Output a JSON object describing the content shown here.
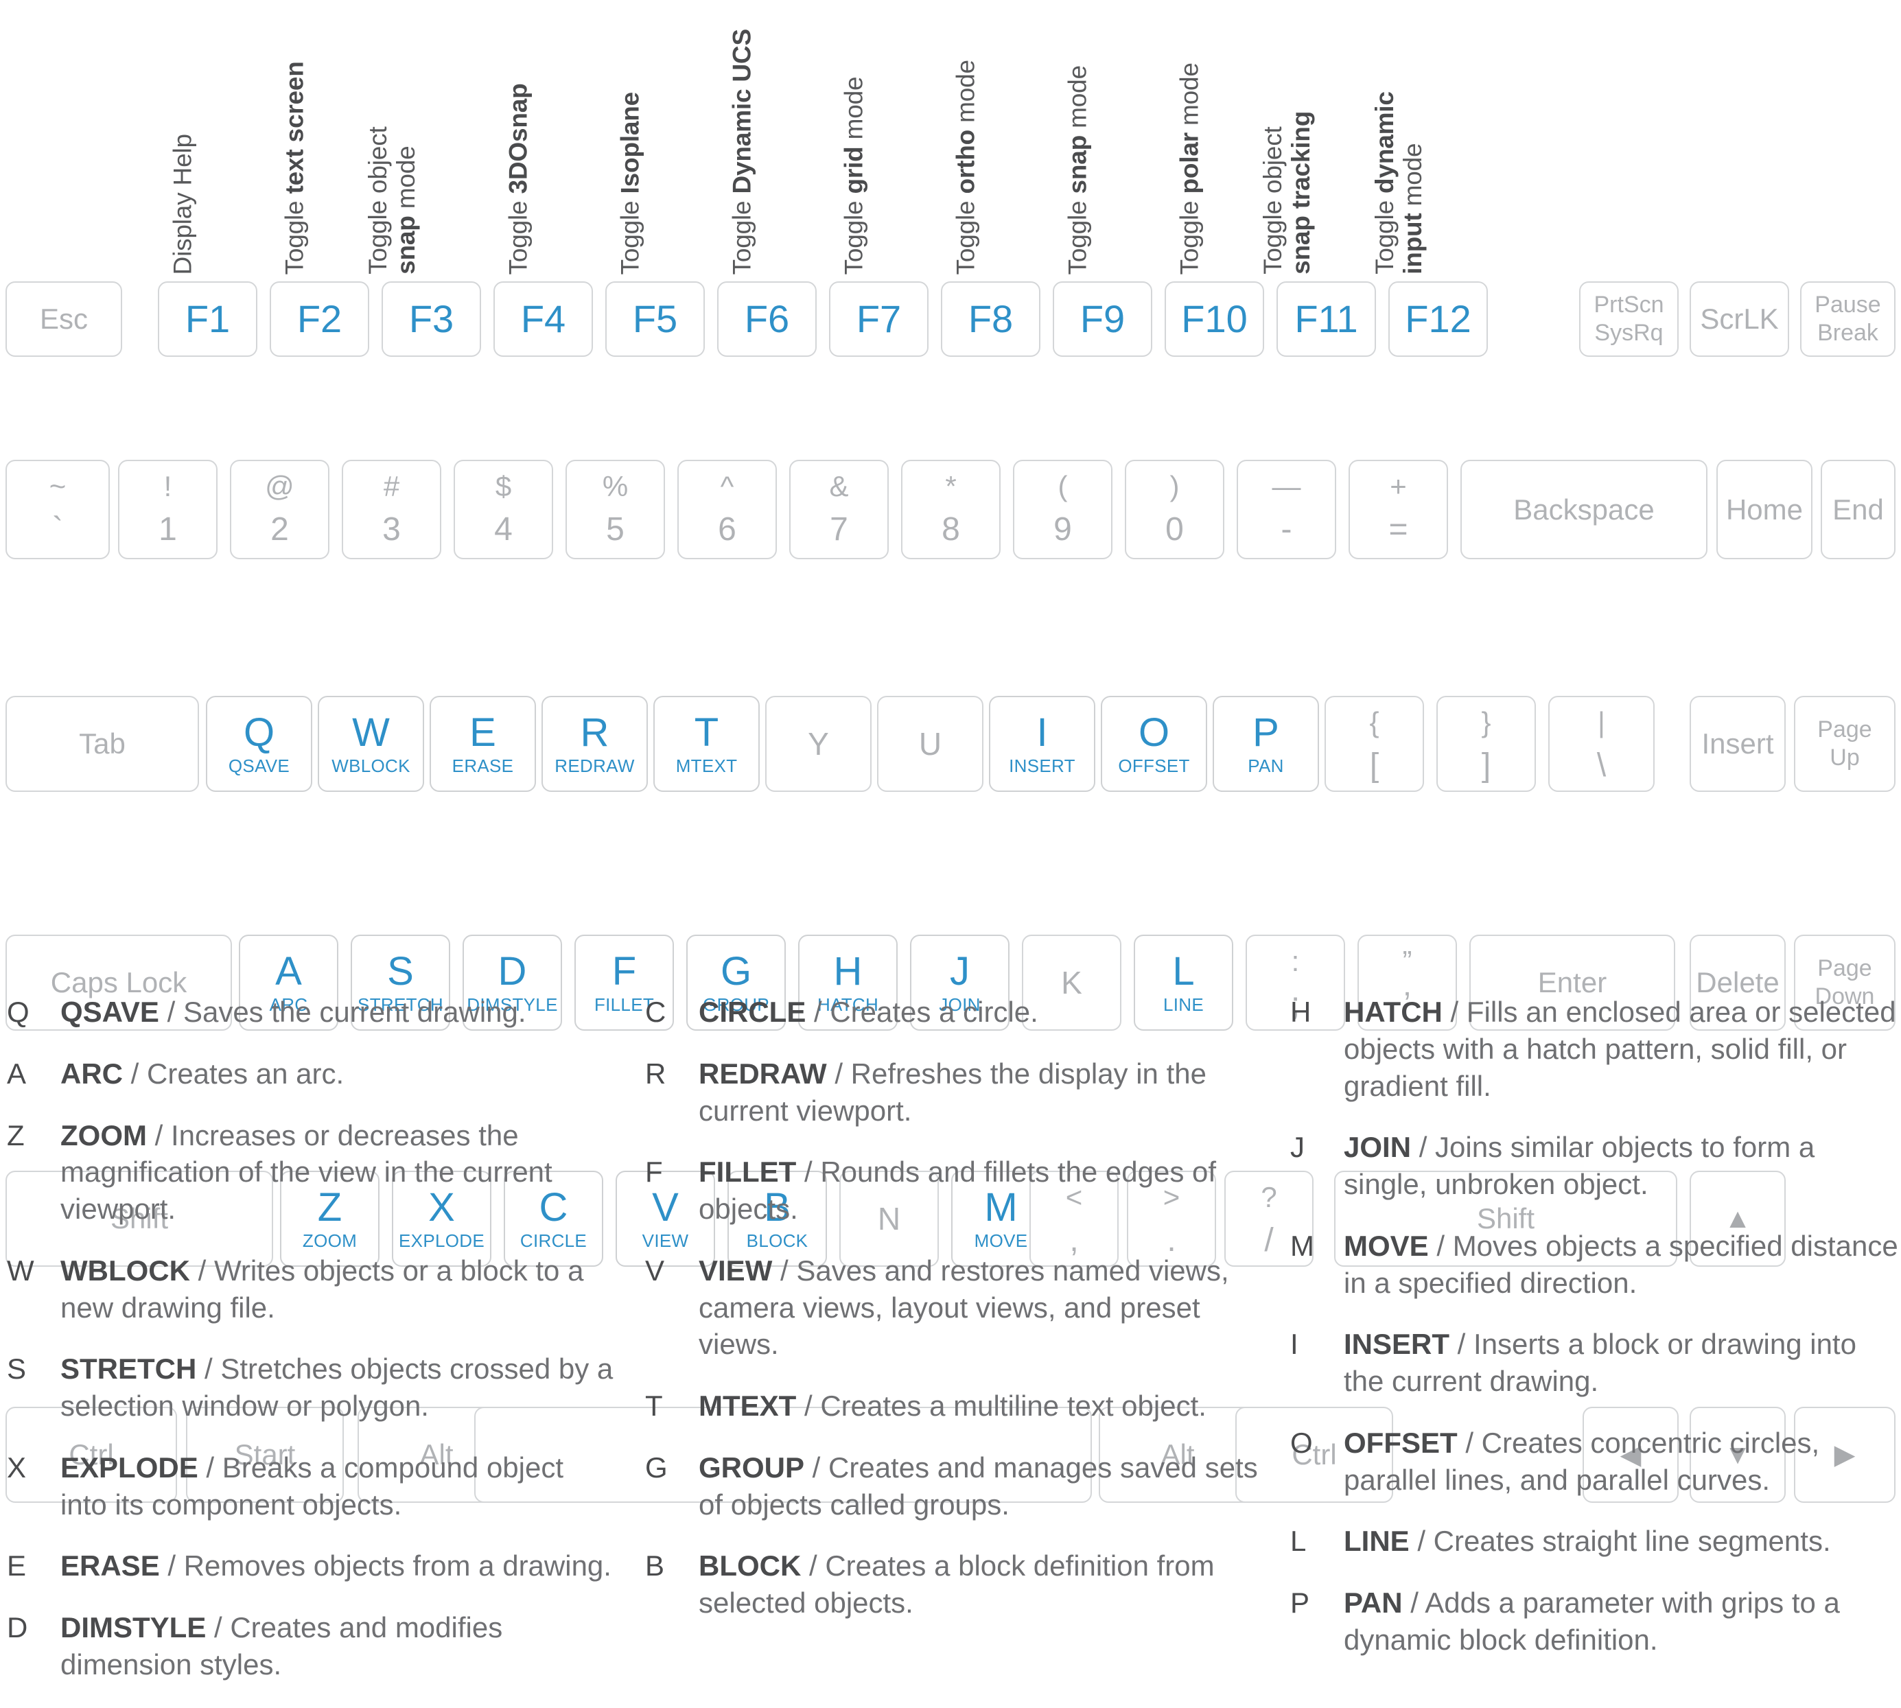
{
  "colors": {
    "accent_blue": "#2e90c8",
    "key_gray": "#b0b2b5",
    "key_border": "#d4d6d8",
    "text_dark": "#4a4b4d",
    "text_body": "#6f7073"
  },
  "fkey_captions": [
    {
      "key": "F1",
      "line1": "Display Help",
      "line2": "",
      "bold1": "",
      "bold2": ""
    },
    {
      "key": "F2",
      "line1": "Toggle text screen",
      "line2": "",
      "bold1": "text screen",
      "bold2": ""
    },
    {
      "key": "F3",
      "line1": "Toggle object",
      "line2": "snap mode",
      "bold1": "",
      "bold2": "snap"
    },
    {
      "key": "F4",
      "line1": "Toggle 3DOsnap",
      "line2": "",
      "bold1": "3DOsnap",
      "bold2": ""
    },
    {
      "key": "F5",
      "line1": "Toggle Isoplane",
      "line2": "",
      "bold1": "Isoplane",
      "bold2": ""
    },
    {
      "key": "F6",
      "line1": "Toggle Dynamic UCS",
      "line2": "",
      "bold1": "Dynamic UCS",
      "bold2": ""
    },
    {
      "key": "F7",
      "line1": "Toggle grid mode",
      "line2": "",
      "bold1": "grid",
      "bold2": ""
    },
    {
      "key": "F8",
      "line1": "Toggle ortho mode",
      "line2": "",
      "bold1": "ortho",
      "bold2": ""
    },
    {
      "key": "F9",
      "line1": "Toggle snap mode",
      "line2": "",
      "bold1": "snap",
      "bold2": ""
    },
    {
      "key": "F10",
      "line1": "Toggle polar mode",
      "line2": "",
      "bold1": "polar",
      "bold2": ""
    },
    {
      "key": "F11",
      "line1": "Toggle object",
      "line2": "snap tracking",
      "bold1": "",
      "bold2": "snap tracking"
    },
    {
      "key": "F12",
      "line1": "Toggle dynamic",
      "line2": "input mode",
      "bold1": "dynamic",
      "bold2": "input"
    }
  ],
  "keyboard": {
    "row_fkeys": [
      {
        "type": "word",
        "label": "Esc"
      },
      {
        "type": "fkey",
        "label": "F1"
      },
      {
        "type": "fkey",
        "label": "F2"
      },
      {
        "type": "fkey",
        "label": "F3"
      },
      {
        "type": "fkey",
        "label": "F4"
      },
      {
        "type": "fkey",
        "label": "F5"
      },
      {
        "type": "fkey",
        "label": "F6"
      },
      {
        "type": "fkey",
        "label": "F7"
      },
      {
        "type": "fkey",
        "label": "F8"
      },
      {
        "type": "fkey",
        "label": "F9"
      },
      {
        "type": "fkey",
        "label": "F10"
      },
      {
        "type": "fkey",
        "label": "F11"
      },
      {
        "type": "fkey",
        "label": "F12"
      },
      {
        "type": "stack",
        "line1": "PrtScn",
        "line2": "SysRq"
      },
      {
        "type": "word",
        "label": "ScrLK"
      },
      {
        "type": "stack",
        "line1": "Pause",
        "line2": "Break"
      }
    ],
    "row_numbers": [
      {
        "type": "dual",
        "top": "~",
        "bot": "`"
      },
      {
        "type": "dual",
        "top": "!",
        "bot": "1"
      },
      {
        "type": "dual",
        "top": "@",
        "bot": "2"
      },
      {
        "type": "dual",
        "top": "#",
        "bot": "3"
      },
      {
        "type": "dual",
        "top": "$",
        "bot": "4"
      },
      {
        "type": "dual",
        "top": "%",
        "bot": "5"
      },
      {
        "type": "dual",
        "top": "^",
        "bot": "6"
      },
      {
        "type": "dual",
        "top": "&",
        "bot": "7"
      },
      {
        "type": "dual",
        "top": "*",
        "bot": "8"
      },
      {
        "type": "dual",
        "top": "(",
        "bot": "9"
      },
      {
        "type": "dual",
        "top": ")",
        "bot": "0"
      },
      {
        "type": "dual",
        "top": "—",
        "bot": "-"
      },
      {
        "type": "dual",
        "top": "+",
        "bot": "="
      },
      {
        "type": "word",
        "label": "Backspace"
      },
      {
        "type": "word",
        "label": "Home"
      },
      {
        "type": "word",
        "label": "End"
      }
    ],
    "row_qwerty": [
      {
        "type": "word",
        "label": "Tab"
      },
      {
        "type": "cmd",
        "label": "Q",
        "cmd": "QSAVE"
      },
      {
        "type": "cmd",
        "label": "W",
        "cmd": "WBLOCK"
      },
      {
        "type": "cmd",
        "label": "E",
        "cmd": "ERASE"
      },
      {
        "type": "cmd",
        "label": "R",
        "cmd": "REDRAW"
      },
      {
        "type": "cmd",
        "label": "T",
        "cmd": "MTEXT"
      },
      {
        "type": "plain",
        "label": "Y"
      },
      {
        "type": "plain",
        "label": "U"
      },
      {
        "type": "cmd",
        "label": "I",
        "cmd": "INSERT"
      },
      {
        "type": "cmd",
        "label": "O",
        "cmd": "OFFSET"
      },
      {
        "type": "cmd",
        "label": "P",
        "cmd": "PAN"
      },
      {
        "type": "dual",
        "top": "{",
        "bot": "["
      },
      {
        "type": "dual",
        "top": "}",
        "bot": "]"
      },
      {
        "type": "dual",
        "top": "|",
        "bot": "\\"
      },
      {
        "type": "word",
        "label": "Insert"
      },
      {
        "type": "stack",
        "line1": "Page",
        "line2": "Up"
      }
    ],
    "row_asdf": [
      {
        "type": "word",
        "label": "Caps Lock"
      },
      {
        "type": "cmd",
        "label": "A",
        "cmd": "ARC"
      },
      {
        "type": "cmd",
        "label": "S",
        "cmd": "STRETCH"
      },
      {
        "type": "cmd",
        "label": "D",
        "cmd": "DIMSTYLE"
      },
      {
        "type": "cmd",
        "label": "F",
        "cmd": "FILLET"
      },
      {
        "type": "cmd",
        "label": "G",
        "cmd": "GROUP"
      },
      {
        "type": "cmd",
        "label": "H",
        "cmd": "HATCH"
      },
      {
        "type": "cmd",
        "label": "J",
        "cmd": "JOIN"
      },
      {
        "type": "plain",
        "label": "K"
      },
      {
        "type": "cmd",
        "label": "L",
        "cmd": "LINE"
      },
      {
        "type": "dual",
        "top": ":",
        "bot": ";"
      },
      {
        "type": "dual",
        "top": "”",
        "bot": "’"
      },
      {
        "type": "word",
        "label": "Enter"
      },
      {
        "type": "word",
        "label": "Delete"
      },
      {
        "type": "stack",
        "line1": "Page",
        "line2": "Down"
      }
    ],
    "row_zxcv": [
      {
        "type": "word",
        "label": "Shift"
      },
      {
        "type": "cmd",
        "label": "Z",
        "cmd": "ZOOM"
      },
      {
        "type": "cmd",
        "label": "X",
        "cmd": "EXPLODE"
      },
      {
        "type": "cmd",
        "label": "C",
        "cmd": "CIRCLE"
      },
      {
        "type": "cmd",
        "label": "V",
        "cmd": "VIEW"
      },
      {
        "type": "cmd",
        "label": "B",
        "cmd": "BLOCK"
      },
      {
        "type": "plain",
        "label": "N"
      },
      {
        "type": "cmd",
        "label": "M",
        "cmd": "MOVE"
      },
      {
        "type": "dual",
        "top": "<",
        "bot": ","
      },
      {
        "type": "dual",
        "top": ">",
        "bot": "."
      },
      {
        "type": "dual",
        "top": "?",
        "bot": "/"
      },
      {
        "type": "word",
        "label": "Shift"
      },
      {
        "type": "arrow",
        "glyph": "▲",
        "name": "arrow-up"
      }
    ],
    "row_bottom": [
      {
        "type": "word",
        "label": "Ctrl"
      },
      {
        "type": "word",
        "label": "Start"
      },
      {
        "type": "word",
        "label": "Alt"
      },
      {
        "type": "word",
        "label": ""
      },
      {
        "type": "word",
        "label": "Alt"
      },
      {
        "type": "word",
        "label": "Ctrl"
      },
      {
        "type": "arrow",
        "glyph": "◀",
        "name": "arrow-left"
      },
      {
        "type": "arrow",
        "glyph": "▼",
        "name": "arrow-down"
      },
      {
        "type": "arrow",
        "glyph": "▶",
        "name": "arrow-right"
      }
    ]
  },
  "legend": {
    "column1": [
      {
        "key": "Q",
        "cmd": "QSAVE",
        "desc": " / Saves the current drawing."
      },
      {
        "key": "A",
        "cmd": "ARC",
        "desc": " / Creates an arc."
      },
      {
        "key": "Z",
        "cmd": "ZOOM",
        "desc": " / Increases or decreases the magnification of the view in the current viewport."
      },
      {
        "key": "W",
        "cmd": "WBLOCK",
        "desc": " / Writes objects or a block to a new drawing file."
      },
      {
        "key": "S",
        "cmd": "STRETCH",
        "desc": " / Stretches objects crossed by a selection window or polygon."
      },
      {
        "key": "X",
        "cmd": "EXPLODE",
        "desc": " / Breaks a compound object into its component objects."
      },
      {
        "key": "E",
        "cmd": "ERASE",
        "desc": " / Removes objects from a drawing."
      },
      {
        "key": "D",
        "cmd": "DIMSTYLE",
        "desc": " / Creates and modifies dimension styles."
      }
    ],
    "column2": [
      {
        "key": "C",
        "cmd": "CIRCLE",
        "desc": " / Creates a circle."
      },
      {
        "key": "R",
        "cmd": "REDRAW",
        "desc": " / Refreshes the display in the current viewport."
      },
      {
        "key": "F",
        "cmd": "FILLET",
        "desc": " / Rounds and fillets the edges of objects."
      },
      {
        "key": "V",
        "cmd": "VIEW",
        "desc": " / Saves and restores named views, camera views, layout views, and preset views."
      },
      {
        "key": "T",
        "cmd": "MTEXT",
        "desc": " / Creates a multiline text object."
      },
      {
        "key": "G",
        "cmd": "GROUP",
        "desc": " / Creates and manages saved sets of objects called groups."
      },
      {
        "key": "B",
        "cmd": "BLOCK",
        "desc": " / Creates a block definition from selected objects."
      }
    ],
    "column3": [
      {
        "key": "H",
        "cmd": "HATCH",
        "desc": " / Fills an enclosed area or selected objects with a hatch pattern, solid fill, or gradient fill."
      },
      {
        "key": "J",
        "cmd": "JOIN",
        "desc": " / Joins similar objects to form a single, unbroken object."
      },
      {
        "key": "M",
        "cmd": "MOVE",
        "desc": " / Moves objects a specified distance in a specified direction."
      },
      {
        "key": "I",
        "cmd": "INSERT",
        "desc": " / Inserts a block or drawing into the current drawing."
      },
      {
        "key": "O",
        "cmd": "OFFSET",
        "desc": " / Creates concentric circles, parallel lines, and parallel curves."
      },
      {
        "key": "L",
        "cmd": "LINE",
        "desc": " / Creates straight line segments."
      },
      {
        "key": "P",
        "cmd": "PAN",
        "desc": " / Adds a parameter with grips to a dynamic block definition."
      }
    ]
  }
}
